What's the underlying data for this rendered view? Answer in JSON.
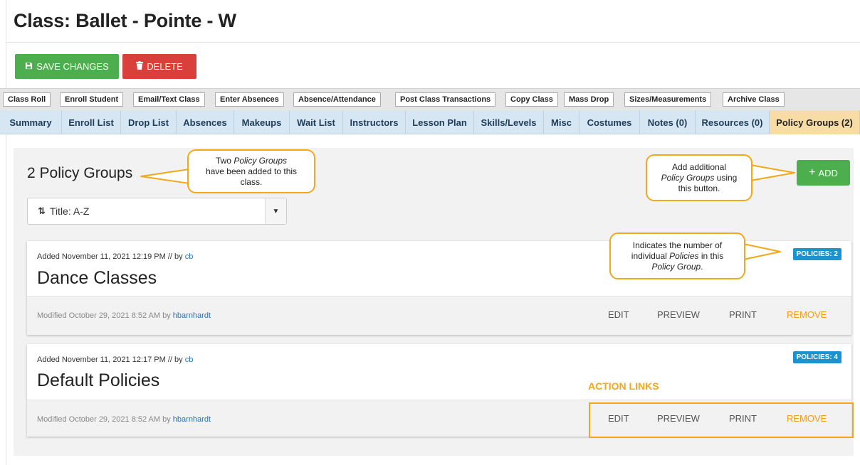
{
  "page": {
    "title": "Class: Ballet - Pointe - W"
  },
  "toolbar": {
    "save_label": "SAVE CHANGES",
    "delete_label": "DELETE"
  },
  "actions": [
    "Class Roll",
    "Enroll Student",
    "Email/Text Class",
    "Enter Absences",
    "Absence/Attendance",
    "Post Class Transactions",
    "Copy Class",
    "Mass Drop",
    "Sizes/Measurements",
    "Archive Class"
  ],
  "tabs": [
    "Summary",
    "Enroll List",
    "Drop List",
    "Absences",
    "Makeups",
    "Wait List",
    "Instructors",
    "Lesson Plan",
    "Skills/Levels",
    "Misc",
    "Costumes",
    "Notes (0)",
    "Resources (0)",
    "Policy Groups (2)"
  ],
  "active_tab": "Policy Groups (2)",
  "policy_section": {
    "count_label": "2 Policy Groups",
    "sort_label": "Title: A-Z",
    "add_label": "ADD"
  },
  "cards": [
    {
      "added_prefix": "Added November 11, 2021 12:19 PM // by",
      "added_by": "cb",
      "title": "Dance Classes",
      "badge": "POLICIES: 2",
      "modified_prefix": "Modified October 29, 2021 8:52 AM by",
      "modified_by": "hbarnhardt",
      "links": {
        "edit": "EDIT",
        "preview": "PREVIEW",
        "print": "PRINT",
        "remove": "REMOVE"
      }
    },
    {
      "added_prefix": "Added November 11, 2021 12:17 PM // by",
      "added_by": "cb",
      "title": "Default Policies",
      "badge": "POLICIES: 4",
      "modified_prefix": "Modified October 29, 2021 8:52 AM by",
      "modified_by": "hbarnhardt",
      "links": {
        "edit": "EDIT",
        "preview": "PREVIEW",
        "print": "PRINT",
        "remove": "REMOVE"
      }
    }
  ],
  "callouts": {
    "groups": {
      "l1a": "Two ",
      "l1b": "Policy Groups",
      "l2": "have been added to this",
      "l3": "class."
    },
    "add": {
      "l1": "Add additional",
      "l2a": "Policy Groups",
      "l2b": " using",
      "l3": "this button."
    },
    "badge": {
      "l1": "Indicates the number of",
      "l2a": "individual ",
      "l2b": "Policies",
      "l2c": " in this",
      "l3a": "Policy Group",
      "l3b": "."
    },
    "action_links": "ACTION LINKS"
  },
  "colors": {
    "accent_green": "#4cae4c",
    "danger_red": "#d9403b",
    "callout_orange": "#f2a818",
    "badge_blue": "#1b93d1",
    "active_tab": "#f7dca5"
  },
  "icons": {
    "save": "floppy-disk-icon",
    "delete": "trash-icon",
    "sort": "sort-arrows-icon",
    "caret": "caret-down-icon"
  }
}
